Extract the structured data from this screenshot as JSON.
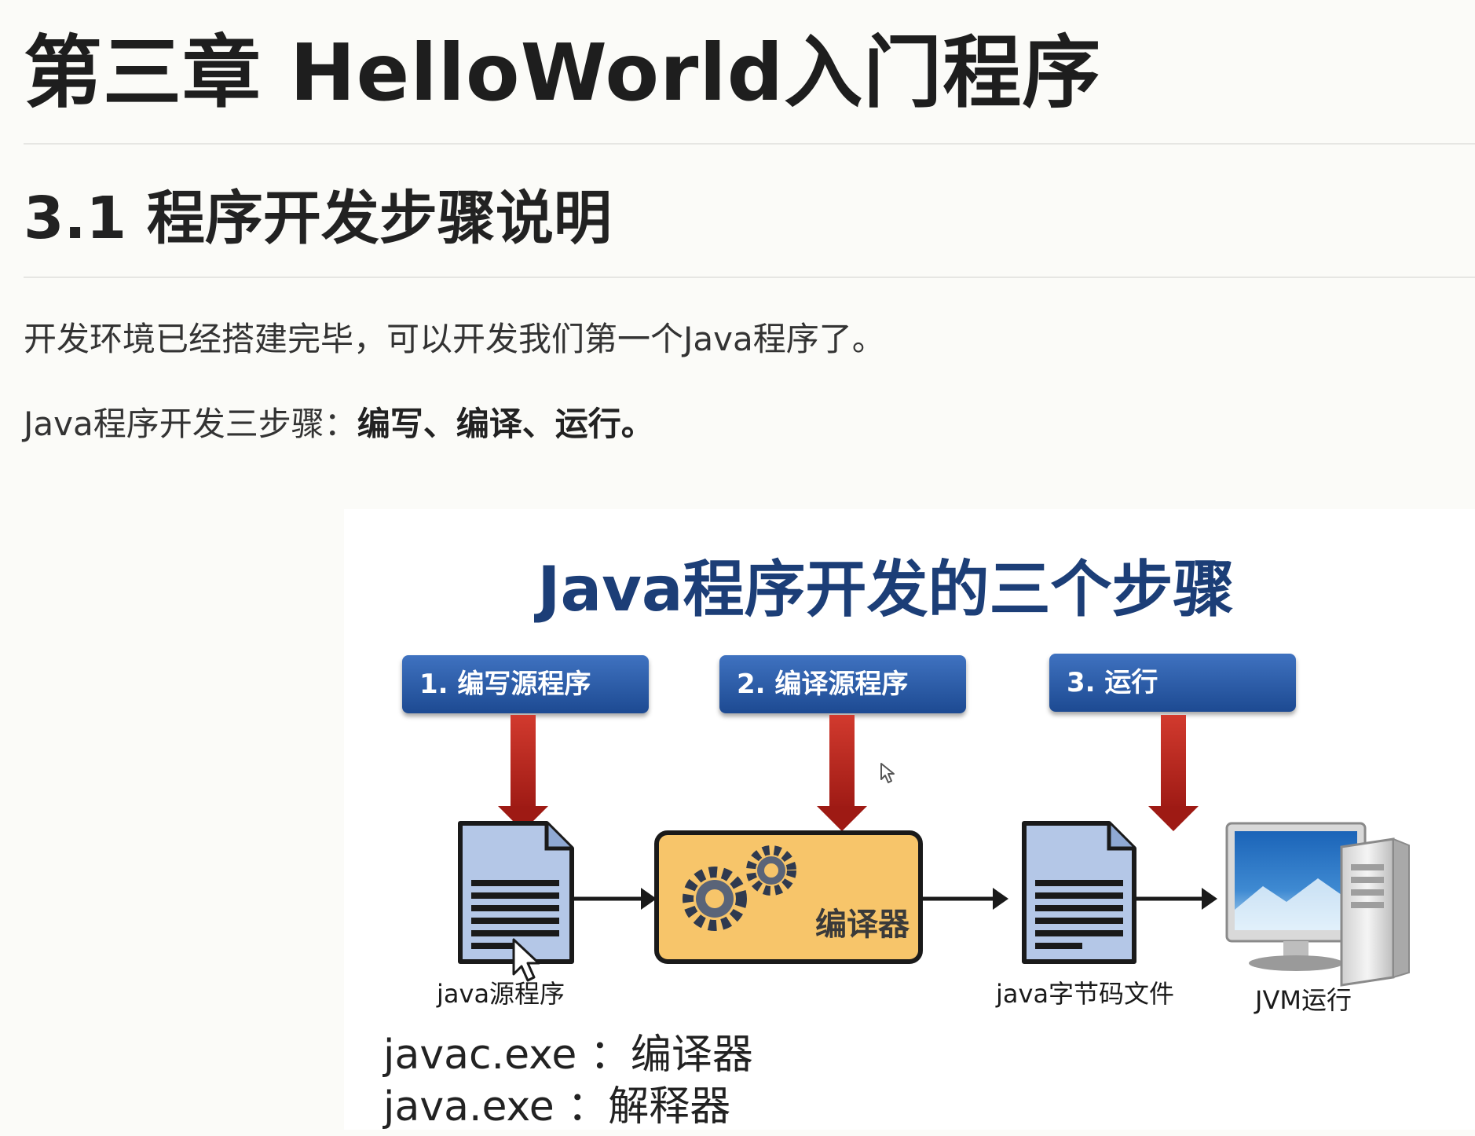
{
  "chapter_title": "第三章 HelloWorld入门程序",
  "section_title": "3.1 程序开发步骤说明",
  "intro": "开发环境已经搭建完毕，可以开发我们第一个Java程序了。",
  "steps_line": {
    "prefix": "Java程序开发三步骤：",
    "emphasis": "编写、编译、运行。"
  },
  "figure": {
    "title": "Java程序开发的三个步骤",
    "steps": [
      {
        "label": "1. 编写源程序"
      },
      {
        "label": "2. 编译源程序"
      },
      {
        "label": "3. 运行"
      }
    ],
    "compiler_label": "编译器",
    "captions": {
      "source": "java源程序",
      "bytecode": "java字节码文件",
      "jvm": "JVM运行"
    },
    "commands": {
      "javac": "javac.exe ：编译器",
      "java": "java.exe ：解释器"
    },
    "colors": {
      "title": "#1c3e77",
      "step_box": "#2a5caa",
      "arrow": "#b2201c",
      "document": "#b4c7e7",
      "compiler": "#f7c56a"
    },
    "icons": [
      "document-icon",
      "gear-icon",
      "computer-icon",
      "mouse-cursor-icon"
    ]
  }
}
